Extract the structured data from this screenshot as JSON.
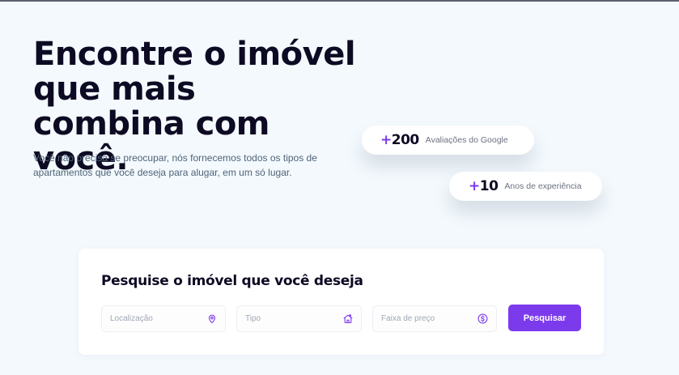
{
  "hero": {
    "title": "Encontre o imóvel que mais combina com você.",
    "subtitle": "Você não precisa se preocupar, nós fornecemos todos os tipos de apartamentos que você deseja para alugar, em um só lugar."
  },
  "stats": [
    {
      "plus": "+",
      "number": "200",
      "label": "Avaliações do Google"
    },
    {
      "plus": "+",
      "number": "10",
      "label": "Anos de experiência"
    }
  ],
  "search": {
    "title": "Pesquise o imóvel que você deseja",
    "fields": [
      {
        "placeholder": "Localização",
        "icon": "location-pin-icon"
      },
      {
        "placeholder": "Tipo",
        "icon": "house-icon"
      },
      {
        "placeholder": "Faixa de preço",
        "icon": "dollar-circle-icon"
      }
    ],
    "button_label": "Pesquisar"
  },
  "colors": {
    "accent": "#7c3aed",
    "background": "#f3f9fd",
    "heading": "#0d0a23",
    "body_text": "#4f6377"
  }
}
